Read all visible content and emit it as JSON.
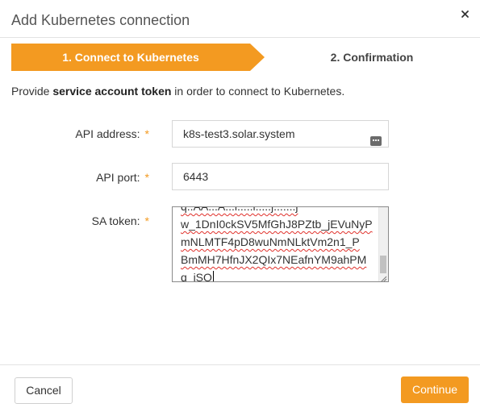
{
  "dialog": {
    "title": "Add Kubernetes connection",
    "close_icon": "close-icon"
  },
  "steps": {
    "active_label": "1. Connect to Kubernetes",
    "next_label": "2. Confirmation",
    "active_color": "#f39a21"
  },
  "intro": {
    "prefix": "Provide ",
    "bold": "service account token",
    "suffix": " in order to connect to Kubernetes."
  },
  "form": {
    "api_address": {
      "label": "API address:",
      "required_mark": "*",
      "value": "k8s-test3.solar.system",
      "icon": "keyboard-icon"
    },
    "api_port": {
      "label": "API port:",
      "required_mark": "*",
      "value": "6443"
    },
    "sa_token": {
      "label": "SA token:",
      "required_mark": "*",
      "lines": [
        "q..AA...A...l.....l.....j.......j",
        "w_1DnI0ckSV5MfGhJ8PZtb_jEVuNyP",
        "mNLMTF4pD8wuNmNLktVm2n1_P",
        "BmMH7HfnJX2QIx7NEafnYM9ahPM",
        "q_jSQ"
      ]
    }
  },
  "footer": {
    "cancel_label": "Cancel",
    "continue_label": "Continue"
  },
  "colors": {
    "accent": "#f39a21",
    "spellcheck": "#e0302a"
  }
}
